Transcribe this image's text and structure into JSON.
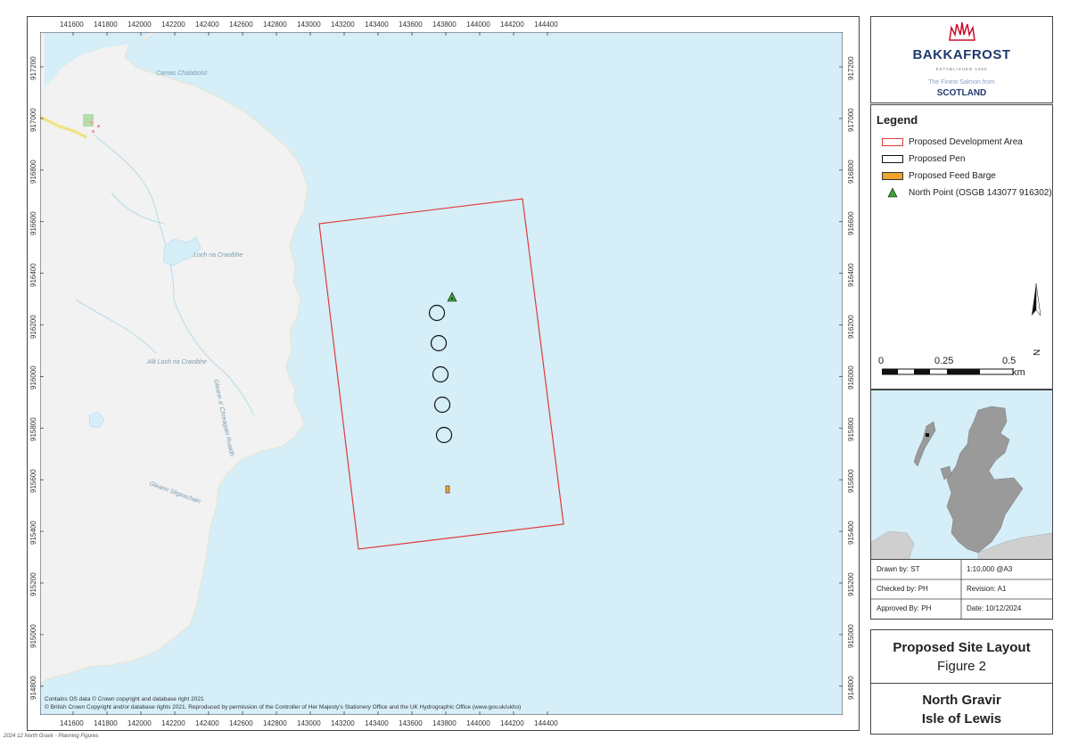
{
  "map": {
    "x_ticks": [
      "141600",
      "141800",
      "142000",
      "142200",
      "142400",
      "142600",
      "142800",
      "143000",
      "143200",
      "143400",
      "143600",
      "143800",
      "144000",
      "144200",
      "144400"
    ],
    "y_ticks": [
      "917200",
      "917000",
      "916800",
      "916600",
      "916400",
      "916200",
      "916000",
      "915800",
      "915600",
      "915400",
      "915200",
      "915000",
      "914800"
    ],
    "place_labels": {
      "camas": "Camas Chalaboist",
      "loch": "Loch na Craoibhe",
      "allt": "Allt Loch na Craoibhe",
      "gleann_creagan": "Gleann a' Chreagain Ruaidh",
      "gleann_sligeachain": "Gleann Sligeachain"
    },
    "credit_line_1": "Contains OS data © Crown copyright and database right 2021",
    "credit_line_2": "© British Crown Copyright and/or database rights 2021. Reproduced by permission of the Controller of Her Majesty's Stationery Office and the UK Hydrographic Office (www.gov.uk/ukho)",
    "colors": {
      "sea": "#d5eef8",
      "land": "#f2f2f2",
      "boundary": "#e03b3b",
      "barge": "#f0a32e",
      "north_point": "#3aa23a"
    }
  },
  "logo": {
    "name": "BAKKAFROST",
    "established": "ESTABLISHED 1968",
    "tagline": "The Finest Salmon from",
    "country": "SCOTLAND"
  },
  "legend": {
    "title": "Legend",
    "items": [
      {
        "label": "Proposed Development Area",
        "icon": "red-outline-rectangle"
      },
      {
        "label": "Proposed Pen",
        "icon": "black-outline-rectangle"
      },
      {
        "label": "Proposed Feed Barge",
        "icon": "orange-rectangle"
      },
      {
        "label": "North Point (OSGB 143077 916302)",
        "icon": "green-triangle"
      }
    ],
    "north_label": "N",
    "scale_labels": [
      "0",
      "0.25",
      "0.5"
    ],
    "scale_unit": "km"
  },
  "info": {
    "drawn_by": "Drawn by: ST",
    "scale": "1:10,000 @A3",
    "checked_by": "Checked by: PH",
    "revision": "Revision: A1",
    "approved_by": "Approved By: PH",
    "date": "Date: 10/12/2024"
  },
  "title": {
    "main": "Proposed Site Layout",
    "figure": "Figure 2",
    "site": "North Gravir",
    "island": "Isle of Lewis"
  },
  "footer": "2024 12 North Gravir - Planning Figures"
}
